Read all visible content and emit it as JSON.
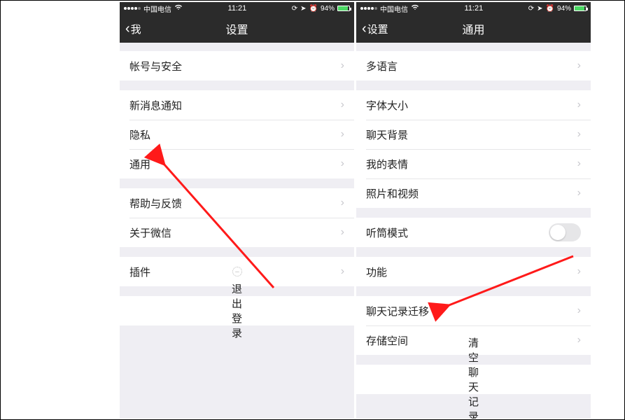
{
  "statusbar": {
    "carrier": "中国电信",
    "time": "11:21",
    "battery_text": "94%"
  },
  "left": {
    "back_label": "我",
    "title": "设置",
    "groups": [
      {
        "items": [
          {
            "label": "帐号与安全",
            "chevron": true
          }
        ]
      },
      {
        "items": [
          {
            "label": "新消息通知",
            "chevron": true
          },
          {
            "label": "隐私",
            "chevron": true
          },
          {
            "label": "通用",
            "chevron": true
          }
        ]
      },
      {
        "items": [
          {
            "label": "帮助与反馈",
            "chevron": true
          },
          {
            "label": "关于微信",
            "chevron": true
          }
        ]
      },
      {
        "items": [
          {
            "label": "插件",
            "chevron": true,
            "plugin_badge": true
          }
        ]
      },
      {
        "items": [
          {
            "label": "退出登录",
            "center": true
          }
        ]
      }
    ]
  },
  "right": {
    "back_label": "设置",
    "title": "通用",
    "groups": [
      {
        "items": [
          {
            "label": "多语言",
            "chevron": true
          }
        ]
      },
      {
        "items": [
          {
            "label": "字体大小",
            "chevron": true
          },
          {
            "label": "聊天背景",
            "chevron": true
          },
          {
            "label": "我的表情",
            "chevron": true
          },
          {
            "label": "照片和视频",
            "chevron": true
          }
        ]
      },
      {
        "items": [
          {
            "label": "听筒模式",
            "toggle": true
          }
        ]
      },
      {
        "items": [
          {
            "label": "功能",
            "chevron": true
          }
        ]
      },
      {
        "items": [
          {
            "label": "聊天记录迁移",
            "chevron": true
          },
          {
            "label": "存储空间",
            "chevron": true
          }
        ]
      },
      {
        "items": [
          {
            "label": "清空聊天记录",
            "center": true
          }
        ]
      }
    ]
  }
}
